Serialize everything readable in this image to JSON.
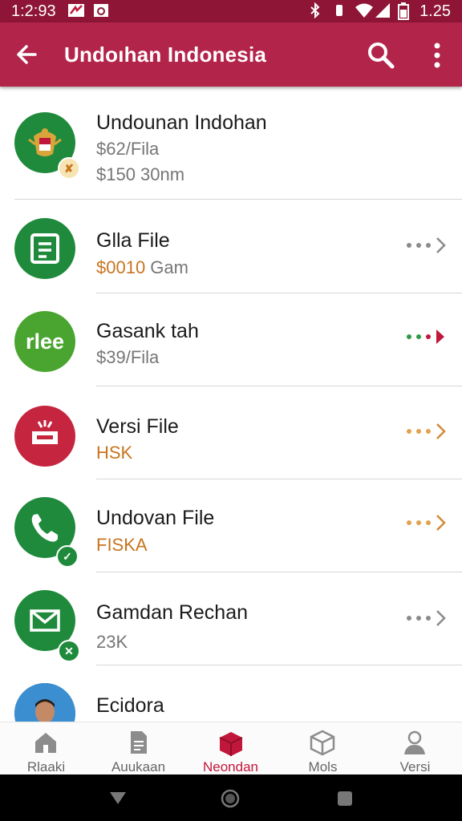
{
  "status_bar": {
    "time": "1:2:93",
    "right_time": "1.25"
  },
  "app_bar": {
    "title": "Undoıhan Indonesia",
    "back_icon": "arrow-left-icon",
    "search_icon": "search-icon",
    "more_icon": "more-vert-icon"
  },
  "list": [
    {
      "title": "Undounan Indohan",
      "line1": "$62/Fila",
      "line2": "$150 30nm",
      "icon": "emblem-icon",
      "color": "#1f8a3b",
      "badge": "✘"
    },
    {
      "title": "Glla File",
      "line1_accent": "$0010",
      "line1_rest": " Gam",
      "icon": "document-icon",
      "color": "#1f8a3b",
      "action": "more-dots-icon"
    },
    {
      "title": "Gasank tah",
      "line1": "$39/Fila",
      "icon": "rlee-logo-icon",
      "logo_text": "rlee",
      "color": "#4aa530",
      "action": "more-dots-red-icon"
    },
    {
      "title": "Versi File",
      "line1": "HSK",
      "icon": "inbox-icon",
      "color": "#c5253f",
      "action": "more-dots-orange-icon"
    },
    {
      "title": "Undovan File",
      "line1": "FISKA",
      "icon": "phone-icon",
      "color": "#1f8a3b",
      "badge": "✓",
      "action": "more-dots-orange-icon"
    },
    {
      "title": "Gamdan Rechan",
      "line1": "23K",
      "icon": "mail-icon",
      "color": "#1f8a3b",
      "badge": "✕",
      "action": "more-dots-icon"
    },
    {
      "title": "Ecidora",
      "icon": "person-photo-icon",
      "color": "#2f7fc0"
    }
  ],
  "bottom_nav": [
    {
      "label": "Rlaaki",
      "icon": "home-icon",
      "active": false
    },
    {
      "label": "Auukaan",
      "icon": "file-icon",
      "active": false
    },
    {
      "label": "Neondan",
      "icon": "box-icon",
      "active": true
    },
    {
      "label": "Mols",
      "icon": "package-icon",
      "active": false
    },
    {
      "label": "Versi",
      "icon": "person-icon",
      "active": false
    }
  ],
  "colors": {
    "app_bar": "#b3244b",
    "status_bar": "#8e1535",
    "accent": "#c1173a",
    "orange_text": "#c8741f"
  }
}
